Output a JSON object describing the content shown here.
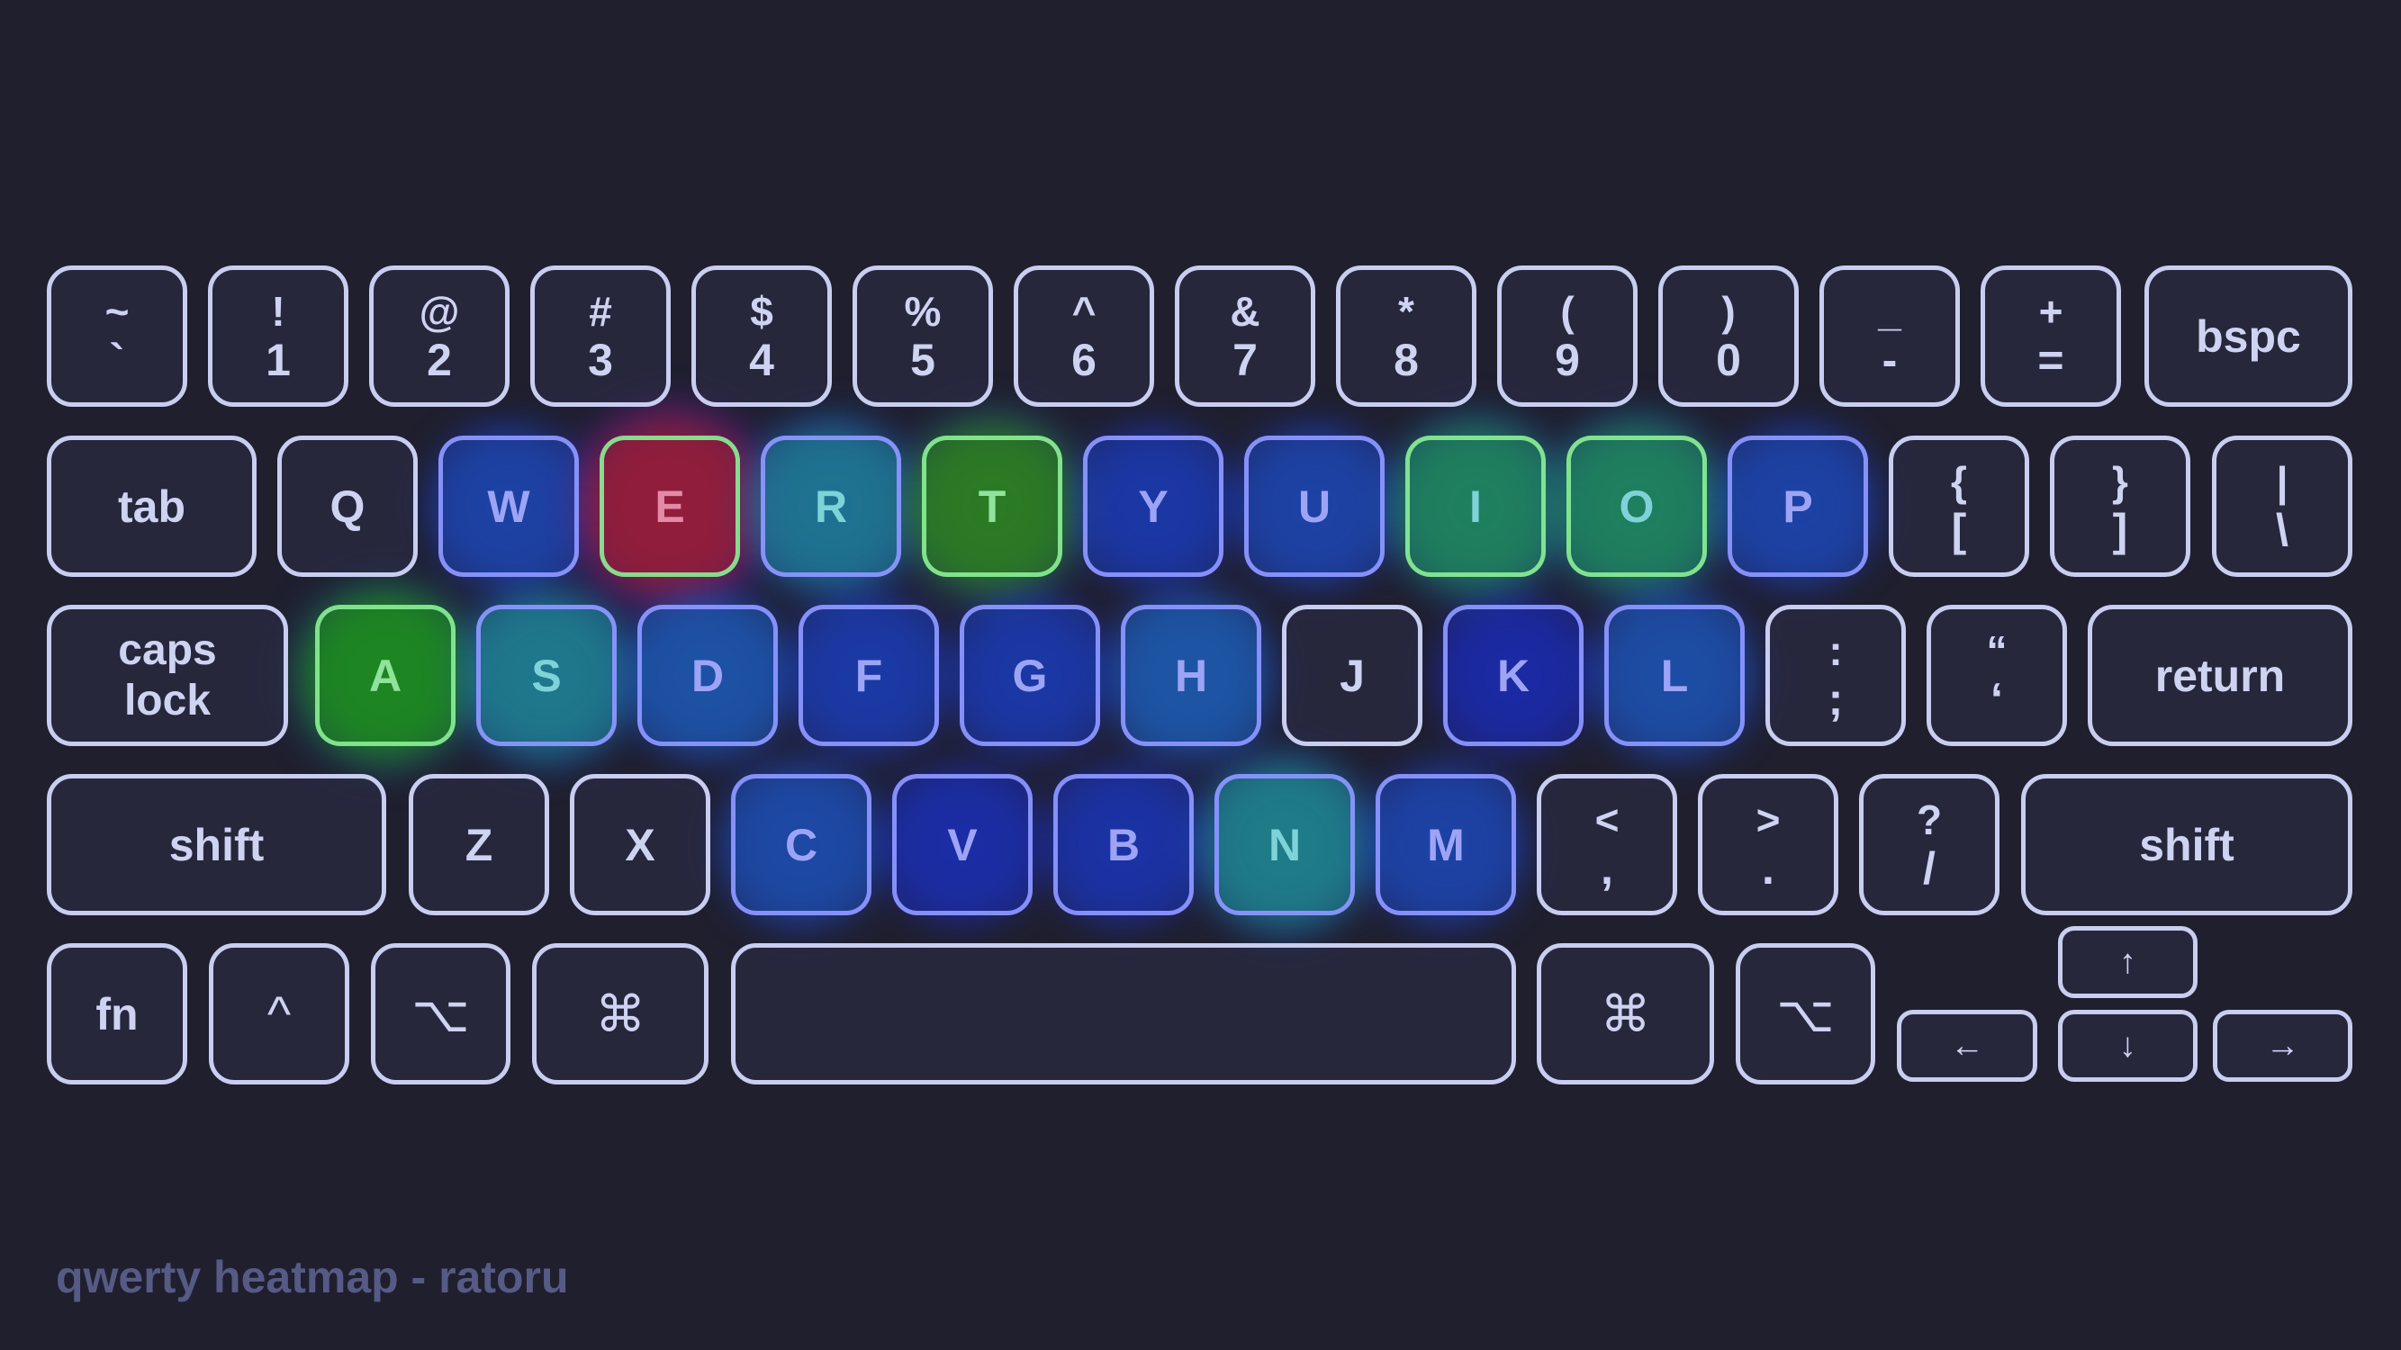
{
  "footer": {
    "caption": "qwerty heatmap - ratoru"
  },
  "colors": {
    "background": "#1f1f2e",
    "key_border": "#c9cdf0",
    "key_text": "#cfd3f2",
    "heat_low": "#1a1aa8",
    "heat_mid": "#1f7fa0",
    "heat_high": "#1e8a22",
    "heat_max": "#8a1e3c"
  },
  "chart_data": {
    "type": "heatmap",
    "title": "qwerty heatmap - ratoru",
    "scale": "relative key frequency (0 = none, 1 = most frequent)",
    "rows": [
      [
        {
          "id": "backtick",
          "top": "~",
          "bottom": "`",
          "intensity": 0
        },
        {
          "id": "1",
          "top": "!",
          "bottom": "1",
          "intensity": 0
        },
        {
          "id": "2",
          "top": "@",
          "bottom": "2",
          "intensity": 0
        },
        {
          "id": "3",
          "top": "#",
          "bottom": "3",
          "intensity": 0
        },
        {
          "id": "4",
          "top": "$",
          "bottom": "4",
          "intensity": 0
        },
        {
          "id": "5",
          "top": "%",
          "bottom": "5",
          "intensity": 0
        },
        {
          "id": "6",
          "top": "^",
          "bottom": "6",
          "intensity": 0
        },
        {
          "id": "7",
          "top": "&",
          "bottom": "7",
          "intensity": 0
        },
        {
          "id": "8",
          "top": "*",
          "bottom": "8",
          "intensity": 0
        },
        {
          "id": "9",
          "top": "(",
          "bottom": "9",
          "intensity": 0
        },
        {
          "id": "0",
          "top": ")",
          "bottom": "0",
          "intensity": 0
        },
        {
          "id": "minus",
          "top": "_",
          "bottom": "-",
          "intensity": 0
        },
        {
          "id": "equals",
          "top": "+",
          "bottom": "=",
          "intensity": 0
        },
        {
          "id": "backspace",
          "label": "bspc",
          "intensity": 0
        }
      ],
      [
        {
          "id": "tab",
          "label": "tab",
          "intensity": 0
        },
        {
          "id": "q",
          "label": "Q",
          "intensity": 0.05
        },
        {
          "id": "w",
          "label": "W",
          "intensity": 0.25
        },
        {
          "id": "e",
          "label": "E",
          "intensity": 1.0
        },
        {
          "id": "r",
          "label": "R",
          "intensity": 0.55
        },
        {
          "id": "t",
          "label": "T",
          "intensity": 0.75
        },
        {
          "id": "y",
          "label": "Y",
          "intensity": 0.18
        },
        {
          "id": "u",
          "label": "U",
          "intensity": 0.25
        },
        {
          "id": "i",
          "label": "I",
          "intensity": 0.65
        },
        {
          "id": "o",
          "label": "O",
          "intensity": 0.65
        },
        {
          "id": "p",
          "label": "P",
          "intensity": 0.25
        },
        {
          "id": "lbracket",
          "top": "{",
          "bottom": "[",
          "intensity": 0
        },
        {
          "id": "rbracket",
          "top": "}",
          "bottom": "]",
          "intensity": 0
        },
        {
          "id": "backslash",
          "top": "|",
          "bottom": "\\",
          "intensity": 0
        }
      ],
      [
        {
          "id": "capslock",
          "label": "caps\nlock",
          "intensity": 0
        },
        {
          "id": "a",
          "label": "A",
          "intensity": 0.72
        },
        {
          "id": "s",
          "label": "S",
          "intensity": 0.58
        },
        {
          "id": "d",
          "label": "D",
          "intensity": 0.35
        },
        {
          "id": "f",
          "label": "F",
          "intensity": 0.2
        },
        {
          "id": "g",
          "label": "G",
          "intensity": 0.18
        },
        {
          "id": "h",
          "label": "H",
          "intensity": 0.38
        },
        {
          "id": "j",
          "label": "J",
          "intensity": 0.02
        },
        {
          "id": "k",
          "label": "K",
          "intensity": 0.1
        },
        {
          "id": "l",
          "label": "L",
          "intensity": 0.32
        },
        {
          "id": "semicolon",
          "top": ":",
          "bottom": ";",
          "intensity": 0
        },
        {
          "id": "quote",
          "top": "“",
          "bottom": "‘",
          "intensity": 0
        },
        {
          "id": "return",
          "label": "return",
          "intensity": 0
        }
      ],
      [
        {
          "id": "lshift",
          "label": "shift",
          "intensity": 0
        },
        {
          "id": "z",
          "label": "Z",
          "intensity": 0.02
        },
        {
          "id": "x",
          "label": "X",
          "intensity": 0.03
        },
        {
          "id": "c",
          "label": "C",
          "intensity": 0.3
        },
        {
          "id": "v",
          "label": "V",
          "intensity": 0.12
        },
        {
          "id": "b",
          "label": "B",
          "intensity": 0.15
        },
        {
          "id": "n",
          "label": "N",
          "intensity": 0.6
        },
        {
          "id": "m",
          "label": "M",
          "intensity": 0.25
        },
        {
          "id": "comma",
          "top": "<",
          "bottom": ",",
          "intensity": 0.03
        },
        {
          "id": "period",
          "top": ">",
          "bottom": ".",
          "intensity": 0.03
        },
        {
          "id": "slash",
          "top": "?",
          "bottom": "/",
          "intensity": 0
        },
        {
          "id": "rshift",
          "label": "shift",
          "intensity": 0
        }
      ],
      [
        {
          "id": "fn",
          "label": "fn",
          "intensity": 0
        },
        {
          "id": "lctrl",
          "label": "^",
          "intensity": 0
        },
        {
          "id": "lopt",
          "label": "⌥",
          "intensity": 0
        },
        {
          "id": "lcmd",
          "label": "⌘",
          "intensity": 0
        },
        {
          "id": "space",
          "label": "",
          "intensity": 0.05
        },
        {
          "id": "rcmd",
          "label": "⌘",
          "intensity": 0
        },
        {
          "id": "ropt",
          "label": "⌥",
          "intensity": 0
        },
        {
          "id": "left",
          "label": "←",
          "intensity": 0
        },
        {
          "id": "up",
          "label": "↑",
          "intensity": 0
        },
        {
          "id": "down",
          "label": "↓",
          "intensity": 0
        },
        {
          "id": "right",
          "label": "→",
          "intensity": 0
        }
      ]
    ]
  }
}
